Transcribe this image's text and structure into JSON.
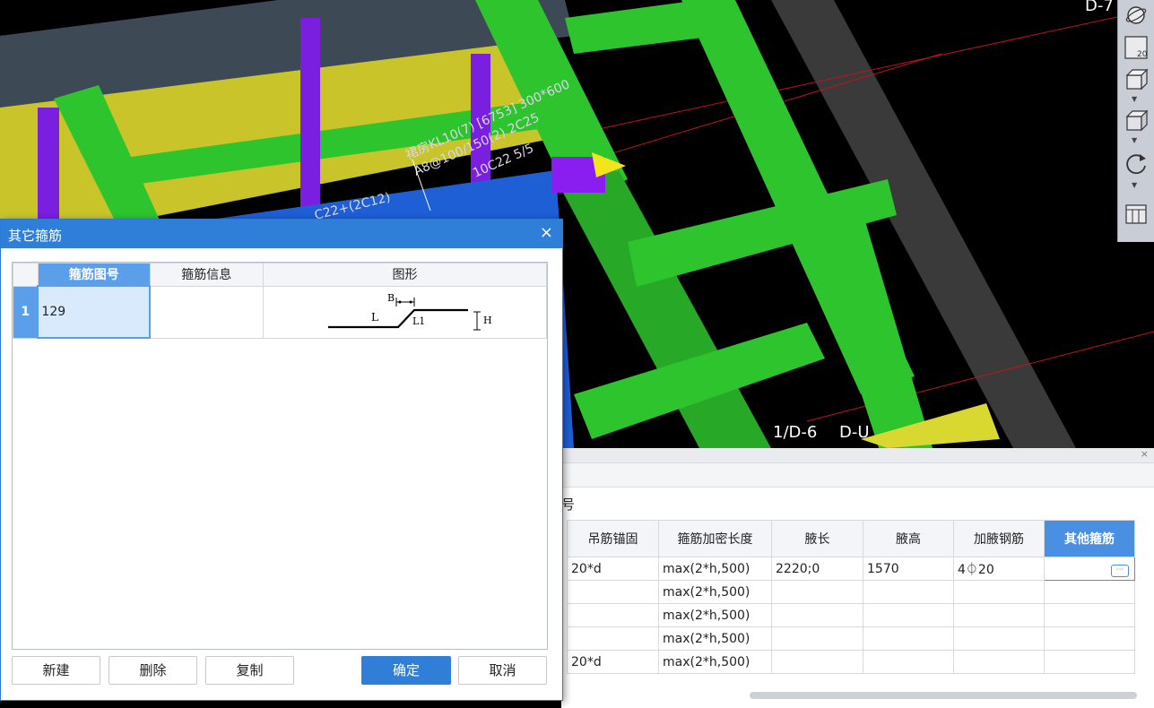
{
  "scene": {
    "beam_annotation_1": "裙房KL10(7) [6753] 300*600",
    "beam_annotation_2": "A8@100/150(2) 2C25",
    "beam_annotation_3": "10C22 5/5",
    "beam_annotation_4": "C22+(2C12)",
    "axis_label_1": "1/D-6",
    "axis_label_2": "D-U",
    "axis_label_3": "D-7"
  },
  "view_toolbar": {
    "items": [
      "orbit-icon",
      "2d-view-icon",
      "3d-box-icon",
      "solid-box-icon",
      "rotate-icon",
      "grid-panel-icon"
    ],
    "label_2d": "20"
  },
  "dialog": {
    "title": "其它箍筋",
    "close_glyph": "×",
    "columns": [
      "箍筋图号",
      "箍筋信息",
      "图形"
    ],
    "rows": [
      {
        "index": "1",
        "shape_no": "129",
        "info": "",
        "shape_labels": {
          "b": "B",
          "l": "L",
          "l1": "L1",
          "h": "H"
        }
      }
    ],
    "buttons": {
      "new": "新建",
      "delete": "删除",
      "copy": "复制",
      "ok": "确定",
      "cancel": "取消"
    }
  },
  "property_panel": {
    "close_glyph": "×",
    "partial_label": "号",
    "columns": [
      "吊筋锚固",
      "箍筋加密长度",
      "腋长",
      "腋高",
      "加腋钢筋",
      "其他箍筋"
    ],
    "rows": [
      [
        "20*d",
        "max(2*h,500)",
        "2220;0",
        "1570",
        "4⏀20",
        ""
      ],
      [
        "",
        "max(2*h,500)",
        "",
        "",
        "",
        ""
      ],
      [
        "",
        "max(2*h,500)",
        "",
        "",
        "",
        ""
      ],
      [
        "",
        "max(2*h,500)",
        "",
        "",
        "",
        ""
      ],
      [
        "20*d",
        "max(2*h,500)",
        "",
        "",
        "",
        ""
      ]
    ],
    "ellipsis": "···"
  },
  "colors": {
    "dialog_title_bar": "#2f7fd8",
    "selected_header": "#5b9fea",
    "beam_green": "#2ec42e",
    "wall_yellow": "#c8c42a",
    "column_purple": "#7a1ee0"
  }
}
